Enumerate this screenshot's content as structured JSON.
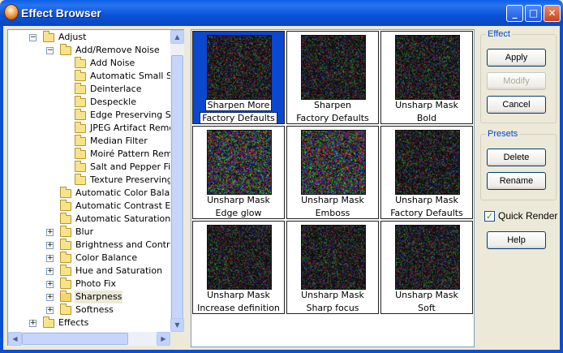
{
  "window": {
    "title": "Effect Browser",
    "minimize": "_",
    "maximize": "□",
    "close": "✕"
  },
  "tree": [
    {
      "label": "Adjust",
      "depth": 1,
      "toggle": "−"
    },
    {
      "label": "Add/Remove Noise",
      "depth": 2,
      "toggle": "−"
    },
    {
      "label": "Add Noise",
      "depth": 3
    },
    {
      "label": "Automatic Small Scra",
      "depth": 3
    },
    {
      "label": "Deinterlace",
      "depth": 3
    },
    {
      "label": "Despeckle",
      "depth": 3
    },
    {
      "label": "Edge Preserving Sm",
      "depth": 3
    },
    {
      "label": "JPEG Artifact Remov",
      "depth": 3
    },
    {
      "label": "Median Filter",
      "depth": 3
    },
    {
      "label": "Moiré Pattern Remov",
      "depth": 3
    },
    {
      "label": "Salt and Pepper Filte",
      "depth": 3
    },
    {
      "label": "Texture Preserving S",
      "depth": 3
    },
    {
      "label": "Automatic Color Balance",
      "depth": 2
    },
    {
      "label": "Automatic Contrast Enha",
      "depth": 2
    },
    {
      "label": "Automatic Saturation Enh",
      "depth": 2
    },
    {
      "label": "Blur",
      "depth": 2,
      "toggle": "+"
    },
    {
      "label": "Brightness and Contrast",
      "depth": 2,
      "toggle": "+"
    },
    {
      "label": "Color Balance",
      "depth": 2,
      "toggle": "+"
    },
    {
      "label": "Hue and Saturation",
      "depth": 2,
      "toggle": "+"
    },
    {
      "label": "Photo Fix",
      "depth": 2,
      "toggle": "+"
    },
    {
      "label": "Sharpness",
      "depth": 2,
      "toggle": "+",
      "selected": true
    },
    {
      "label": "Softness",
      "depth": 2,
      "toggle": "+"
    },
    {
      "label": "Effects",
      "depth": 1,
      "toggle": "+"
    }
  ],
  "presets": [
    {
      "line1": "Sharpen More",
      "line2": "Factory Defaults",
      "selected": true,
      "noise": "dark"
    },
    {
      "line1": "Sharpen",
      "line2": "Factory Defaults",
      "noise": "dark"
    },
    {
      "line1": "Unsharp Mask",
      "line2": "Bold",
      "noise": "dark"
    },
    {
      "line1": "Unsharp Mask",
      "line2": "Edge glow",
      "noise": "bright"
    },
    {
      "line1": "Unsharp Mask",
      "line2": "Emboss",
      "noise": "bright"
    },
    {
      "line1": "Unsharp Mask",
      "line2": "Factory Defaults",
      "noise": "dark"
    },
    {
      "line1": "Unsharp Mask",
      "line2": "Increase definition",
      "noise": "dark"
    },
    {
      "line1": "Unsharp Mask",
      "line2": "Sharp focus",
      "noise": "dark"
    },
    {
      "line1": "Unsharp Mask",
      "line2": "Soft",
      "noise": "dark"
    }
  ],
  "effect_group": {
    "label": "Effect",
    "apply": "Apply",
    "modify": "Modify",
    "cancel": "Cancel"
  },
  "presets_group": {
    "label": "Presets",
    "delete": "Delete",
    "rename": "Rename"
  },
  "quick_render": {
    "label": "Quick Render",
    "checked": true,
    "mark": "✓"
  },
  "help": "Help",
  "scroll": {
    "up": "▲",
    "down": "▼",
    "left": "◀",
    "right": "▶"
  }
}
